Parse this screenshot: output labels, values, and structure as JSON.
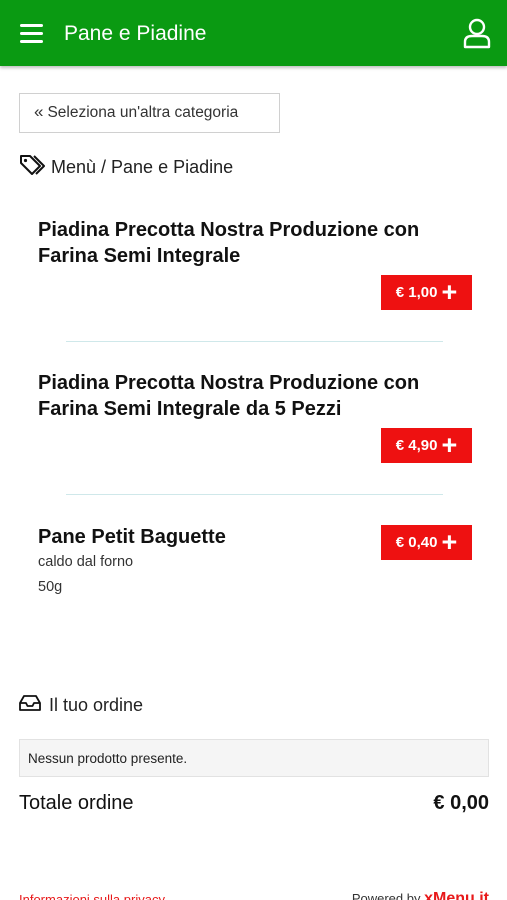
{
  "header": {
    "title": "Pane e Piadine",
    "menu_icon": "hamburger-menu-icon",
    "user_icon": "user-icon",
    "bg_color": "#0a9a12"
  },
  "category_button": {
    "label": "Seleziona un'altra categoria",
    "icon": "double-chevron-left-icon"
  },
  "breadcrumb": {
    "icon": "tags-icon",
    "text": "Menù / Pane e Piadine"
  },
  "products": [
    {
      "name": "Piadina Precotta Nostra Produzione con Farina Semi Integrale",
      "price": "€ 1,00"
    },
    {
      "name": "Piadina Precotta Nostra Produzione con Farina Semi Integrale da 5 Pezzi",
      "price": "€ 4,90"
    },
    {
      "name": "Pane Petit Baguette",
      "description": "caldo dal forno",
      "weight": "50g",
      "price": "€ 0,40"
    }
  ],
  "price_button_color": "#ee1111",
  "order": {
    "icon": "inbox-icon",
    "title": "Il tuo ordine",
    "empty_message": "Nessun prodotto presente.",
    "total_label": "Totale ordine",
    "total_value": "€ 0,00"
  },
  "footer": {
    "privacy_link": "Informazioni sulla privacy",
    "powered_by": "Powered by",
    "brand": "xMenu.it"
  }
}
